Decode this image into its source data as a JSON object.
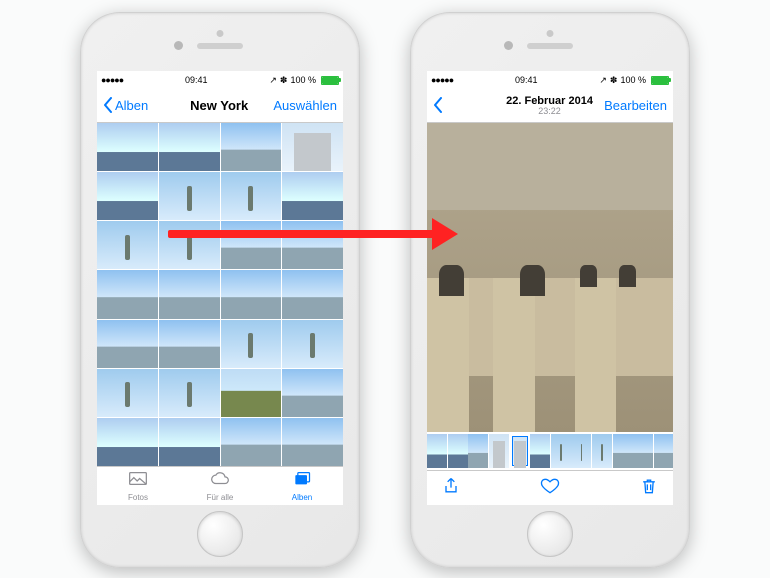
{
  "status": {
    "carrier_dots": "●●●●●",
    "wifi": "wifi-icon",
    "time": "09:41",
    "bt": "✽",
    "battery_pct": "100 %",
    "battery_fill_pct": 100,
    "location": "↗"
  },
  "album_view": {
    "back_label": "Alben",
    "title": "New York",
    "action_label": "Auswählen",
    "thumbs": [
      "water",
      "water",
      "skybg",
      "bldg",
      "water",
      "statue",
      "statue",
      "water",
      "statue",
      "statue",
      "skybg",
      "skybg",
      "skybg",
      "skybg",
      "skybg",
      "skybg",
      "skybg",
      "skybg",
      "statue",
      "statue",
      "statue",
      "statue",
      "green",
      "skybg",
      "water",
      "water",
      "skybg",
      "skybg"
    ],
    "tabs": [
      {
        "id": "fotos",
        "label": "Fotos",
        "icon": "photos-icon",
        "active": false
      },
      {
        "id": "fueralle",
        "label": "Für alle",
        "icon": "cloud-icon",
        "active": false
      },
      {
        "id": "alben",
        "label": "Alben",
        "icon": "albums-icon",
        "active": true
      }
    ]
  },
  "detail_view": {
    "back_label": "",
    "title": "22. Februar 2014",
    "subtitle": "23:22",
    "action_label": "Bearbeiten",
    "filmstrip": [
      "water",
      "water",
      "skybg",
      "bldg",
      "bldg",
      "water",
      "statue",
      "statue",
      "statue",
      "skybg",
      "skybg",
      "skybg"
    ],
    "selected_index": 4,
    "toolbar": {
      "share": "share-icon",
      "favorite": "heart-icon",
      "delete": "trash-icon"
    }
  },
  "colors": {
    "tint": "#007aff",
    "arrow": "#f22",
    "battery": "#2bbf3e"
  }
}
